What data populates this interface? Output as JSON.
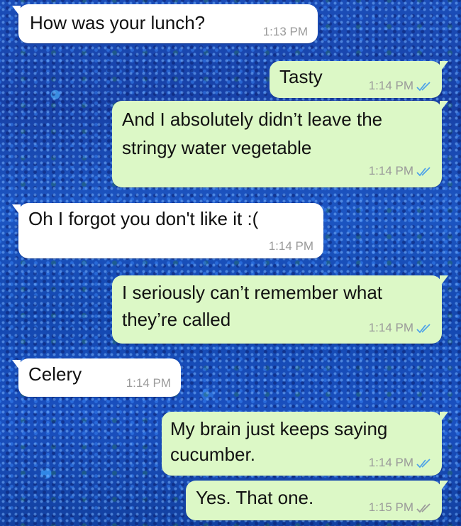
{
  "chat": {
    "messages": [
      {
        "direction": "incoming",
        "lines": [
          "How was your lunch?"
        ],
        "time": "1:13 PM"
      },
      {
        "direction": "outgoing",
        "lines": [
          "Tasty"
        ],
        "time": "1:14 PM",
        "status": "read-double-check-icon"
      },
      {
        "direction": "outgoing",
        "lines": [
          "And I absolutely didn’t leave the",
          "stringy water vegetable"
        ],
        "time": "1:14 PM",
        "status": "read-double-check-icon"
      },
      {
        "direction": "incoming",
        "lines": [
          "Oh I forgot you don't like it :("
        ],
        "time": "1:14 PM"
      },
      {
        "direction": "outgoing",
        "lines": [
          "I seriously can’t remember what",
          "they’re called"
        ],
        "time": "1:14 PM",
        "status": "read-double-check-icon"
      },
      {
        "direction": "incoming",
        "lines": [
          "Celery"
        ],
        "time": "1:14 PM"
      },
      {
        "direction": "outgoing",
        "lines": [
          "My brain just keeps saying",
          "cucumber."
        ],
        "time": "1:14 PM",
        "status": "read-double-check-icon"
      },
      {
        "direction": "outgoing",
        "lines": [
          "Yes. That one."
        ],
        "time": "1:15 PM",
        "status": "delivered-double-check-icon"
      }
    ]
  },
  "colors": {
    "incoming_bubble": "#ffffff",
    "outgoing_bubble": "#dcf8c6",
    "timestamp": "#9a9a9a",
    "read_ticks": "#4fa3e8",
    "delivered_ticks": "#9a9a9a",
    "wallpaper": "#1b4db8"
  }
}
